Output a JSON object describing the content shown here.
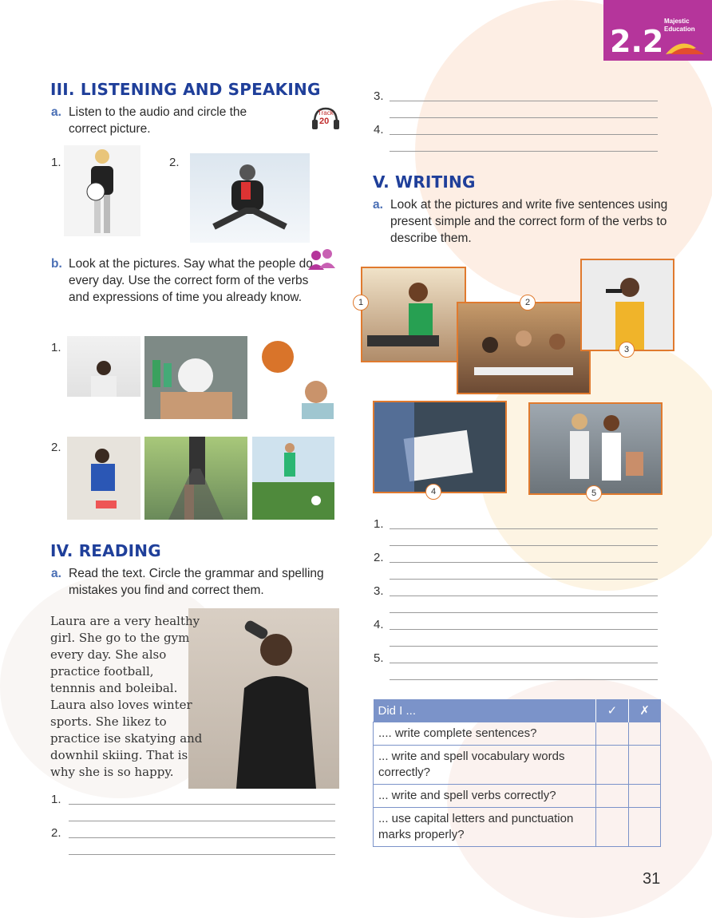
{
  "header": {
    "lesson_number": "2.2",
    "logo_text_1": "Majestic",
    "logo_text_2": "Education"
  },
  "listening": {
    "title": "III. LISTENING AND SPEAKING",
    "a_letter": "a.",
    "a_text": "Listen to the audio and circle the correct picture.",
    "track_label": "Track",
    "track_number": "20",
    "items": [
      "1.",
      "2."
    ],
    "b_letter": "b.",
    "b_text": "Look at the pictures. Say what the people do every day. Use the correct form of the verbs and expressions of time you already know.",
    "b_rows": [
      "1.",
      "2."
    ]
  },
  "reading": {
    "title": "IV. READING",
    "a_letter": "a.",
    "a_text": "Read the text. Circle the grammar and spelling mistakes you find and correct them.",
    "passage": [
      "Laura are a very healthy",
      "girl. She go to the gym",
      "every day. She also",
      "practice football,",
      "tennnis and boleibal.",
      "Laura also loves winter",
      "sports. She likez to",
      "practice ise skatying and",
      "downhil skiing. That is",
      "why she is so happy."
    ],
    "answer_numbers": [
      "1.",
      "2."
    ]
  },
  "left_continued": {
    "answer_numbers": [
      "3.",
      "4."
    ]
  },
  "writing": {
    "title": "V. WRITING",
    "a_letter": "a.",
    "a_text": "Look at the pictures and write five sentences using present simple and the correct form of the verbs to describe them.",
    "picture_badges": [
      "1",
      "2",
      "3",
      "4",
      "5"
    ],
    "answer_numbers": [
      "1.",
      "2.",
      "3.",
      "4.",
      "5."
    ]
  },
  "checklist": {
    "header": "Did I ...",
    "col_check": "✓",
    "col_cross": "✗",
    "rows": [
      ".... write complete sentences?",
      "... write and spell vocabulary words correctly?",
      "... write and spell verbs correctly?",
      "... use capital letters and punctuation marks properly?"
    ]
  },
  "page_number": "31",
  "colors": {
    "heading": "#1f3f9a",
    "accent_letter": "#4a6fb5",
    "badge_bg": "#b5359b",
    "frame": "#e07a2e",
    "table_header": "#7b93c9"
  }
}
